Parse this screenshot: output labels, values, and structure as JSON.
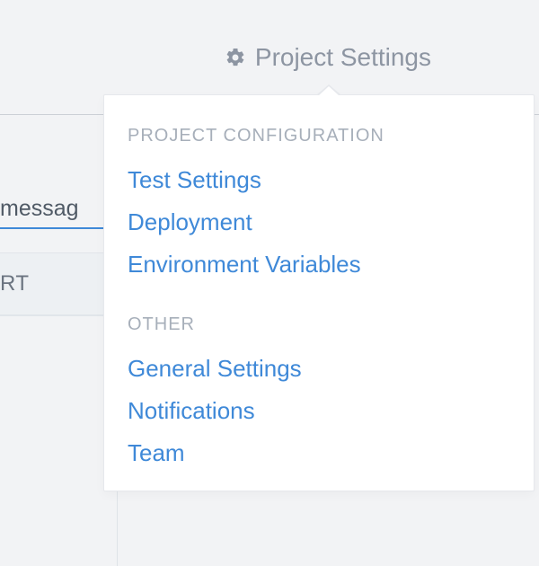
{
  "header": {
    "project_settings": "Project Settings"
  },
  "background": {
    "tab_fragment": "messag",
    "row_fragment": "RT"
  },
  "dropdown": {
    "section1": {
      "header": "PROJECT CONFIGURATION",
      "items": [
        "Test Settings",
        "Deployment",
        "Environment Variables"
      ]
    },
    "section2": {
      "header": "OTHER",
      "items": [
        "General Settings",
        "Notifications",
        "Team"
      ]
    }
  }
}
